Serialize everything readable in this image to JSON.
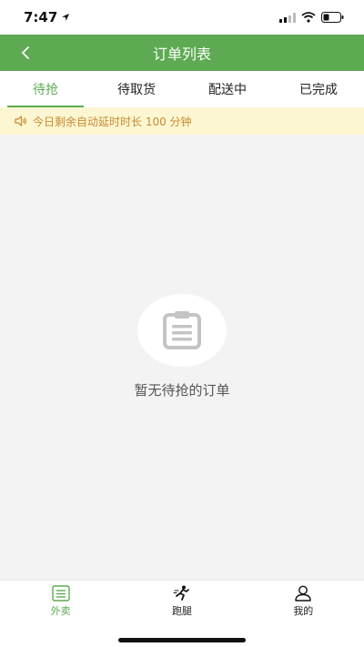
{
  "status_bar": {
    "time": "7:47"
  },
  "header": {
    "title": "订单列表"
  },
  "tabs": [
    {
      "label": "待抢"
    },
    {
      "label": "待取货"
    },
    {
      "label": "配送中"
    },
    {
      "label": "已完成"
    }
  ],
  "notice": {
    "text": "今日剩余自动延时时长 100 分钟"
  },
  "empty_state": {
    "text": "暂无待抢的订单"
  },
  "bottom_nav": {
    "items": [
      {
        "label": "外卖"
      },
      {
        "label": "跑腿"
      },
      {
        "label": "我的"
      }
    ]
  },
  "colors": {
    "brand": "#5daa52",
    "notice_bg": "#fcf6d2",
    "notice_text": "#c88b2f"
  }
}
